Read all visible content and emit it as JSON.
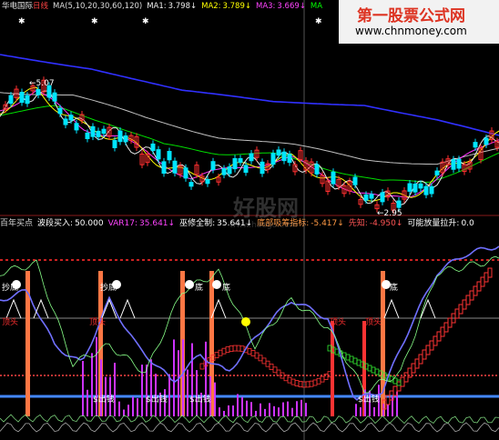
{
  "header": {
    "stock_name": "华电国际",
    "period": "日线",
    "ma_label": "MA(5,10,20,30,60,120)",
    "ma1_label": "MA1:",
    "ma1_value": "3.798↓",
    "ma2_label": "MA2:",
    "ma2_value": "3.789↓",
    "ma3_label": "MA3:",
    "ma3_value": "3.669↓",
    "ma4_label": "MA"
  },
  "price_marks": {
    "high": "5.07",
    "low": "2.95"
  },
  "indicator": {
    "label_prefix": "百年买点",
    "buy_label": "波段买入:",
    "buy_value": "50.000",
    "var17_label": "VAR17:",
    "var17_value": "35.641↓",
    "zuxiu_label": "巫修全制:",
    "zuxiu_value": "35.641↓",
    "dixi_label": "底部吸筹指标:",
    "dixi_value": "-5.417↓",
    "xianzhi_label": "先知:",
    "xianzhi_value": "-4.950↓",
    "kn_label": "可能放量拉升:",
    "kn_value": "0.0"
  },
  "chart_labels": {
    "chaodi": "抄底",
    "dou": "底",
    "dingtou": "顶头",
    "xiaqian": "$出钱"
  },
  "watermark": {
    "site_title": "第一股票公式网",
    "site_url": "www.chnmoney.com",
    "center_mark": "好股网",
    "center_sub": "www.haogu.com"
  },
  "colors": {
    "up": "#ff3030",
    "down": "#00e5ff",
    "ma_white": "#e8e8e8",
    "ma_yellow": "#ffff00",
    "ma_magenta": "#ff33ff",
    "ma_green": "#00dd00",
    "ma_grey": "#c0c0c0",
    "ma_blue": "#3030ff",
    "orange_bar": "#ff7744",
    "purple_bar": "#cc33ff",
    "hline_blue": "#4488ff"
  }
}
